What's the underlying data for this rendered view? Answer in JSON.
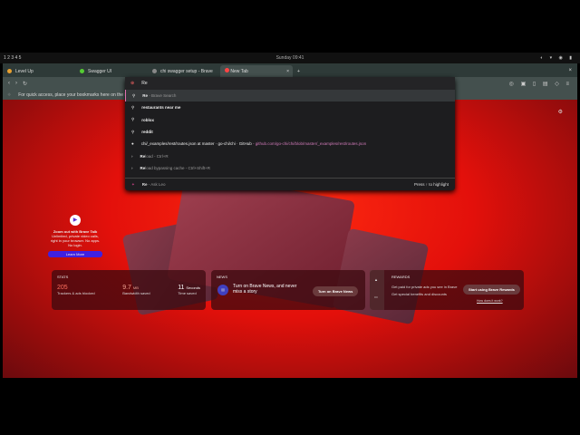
{
  "system": {
    "workspaces": "1 2 3 4 5",
    "clock": "Sunday 09:41"
  },
  "tabs": [
    {
      "label": "Level Up"
    },
    {
      "label": "Swagger UI"
    },
    {
      "label": "chi swagger setup - Brave"
    },
    {
      "label": "New Tab",
      "active": true
    }
  ],
  "bookmarks_hint": "For quick access, place your bookmarks here on the bookmarks bar.",
  "omnibox": {
    "value": "Re",
    "suggestions": [
      {
        "bold": "Re",
        "rest": " - Brave Search",
        "icon": "search-icon"
      },
      {
        "bold": "restaurants near me",
        "rest": "",
        "icon": "search-icon"
      },
      {
        "bold": "roblox",
        "rest": "",
        "icon": "search-icon"
      },
      {
        "bold": "reddit",
        "rest": "",
        "icon": "search-icon"
      },
      {
        "bold": "chi/_examples/rest/routes.json at master · go-chi/chi · GitHub",
        "rest": " - github.com/go-chi/chi/blob/master/_examples/rest/routes.json",
        "icon": "github-icon"
      },
      {
        "bold": "Re",
        "rest": "load - Ctrl+R",
        "icon": "chevron-right-icon"
      },
      {
        "bold": "Re",
        "rest": "load bypassing cache - Ctrl+Shift+R",
        "icon": "chevron-right-icon"
      }
    ],
    "leo": {
      "bold": "Re",
      "rest": " - Ask Leo"
    },
    "hint": "Press ↑ to highlight"
  },
  "talk": {
    "title": "Zoom out with Brave Talk",
    "body": "Unlimited, private video calls, right in your browser. No apps. No login.",
    "button": "Learn More"
  },
  "stats": {
    "title": "STATS",
    "trackers": "205",
    "trackers_label": "Trackers & ads blocked",
    "bandwidth": "9.7",
    "bandwidth_unit": "MB",
    "bandwidth_label": "Bandwidth saved",
    "time": "11",
    "time_unit": "Seconds",
    "time_label": "Time saved"
  },
  "news": {
    "title": "NEWS",
    "text": "Turn on Brave News, and never miss a story",
    "button": "Turn on Brave News"
  },
  "rewards": {
    "title": "REWARDS",
    "items": [
      "Get paid for private ads you see in Brave",
      "Get special benefits and discounts"
    ],
    "button": "Start using Brave Rewards",
    "link": "How does it work?"
  }
}
